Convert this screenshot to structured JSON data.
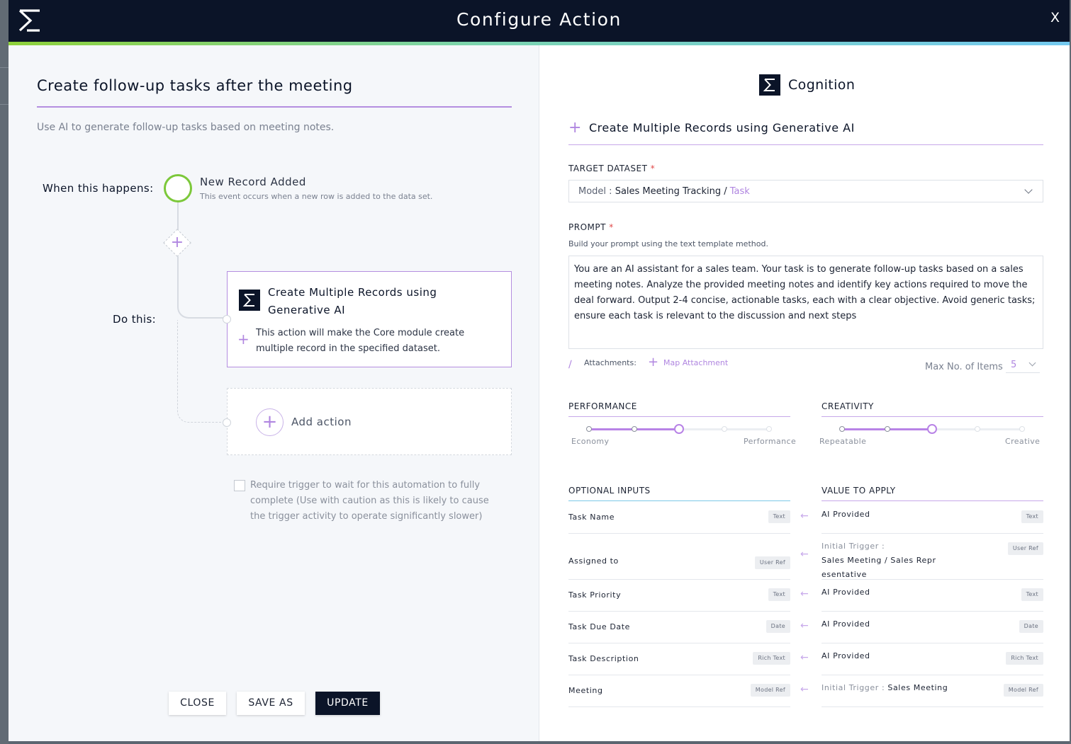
{
  "window": {
    "title": "Configure Action",
    "close_label": "X"
  },
  "workflow": {
    "title": "Create follow-up tasks after the meeting",
    "description": "Use AI to generate follow-up tasks based on meeting notes.",
    "when_label": "When this happens:",
    "do_label": "Do this:",
    "trigger": {
      "name": "New Record Added",
      "description": "This event occurs when a new row is added to the data set."
    },
    "action": {
      "title": "Create Multiple Records using Generative AI",
      "description": "This action will make the Core module create multiple record in the specified dataset."
    },
    "add_action_label": "Add action",
    "wait_checkbox": {
      "checked": false,
      "label": "Require trigger to wait for this automation to fully complete (Use with caution as this is likely to cause the trigger activity to operate significantly slower)"
    }
  },
  "buttons": {
    "close": "CLOSE",
    "save_as": "SAVE AS",
    "update": "UPDATE"
  },
  "config": {
    "brand": "Cognition",
    "section_title": "Create Multiple Records using Generative AI",
    "target_dataset": {
      "label": "TARGET DATASET",
      "model_prefix": "Model :",
      "path": "Sales Meeting Tracking /",
      "entity": "Task"
    },
    "prompt": {
      "label": "PROMPT",
      "help": "Build your prompt using the text template method.",
      "text": "You are an AI assistant for a sales team. Your task is to generate follow-up tasks based on a sales meeting notes. Analyze the provided meeting notes and identify key actions required to move the deal forward. Output 2-4 concise, actionable tasks, each with a clear objective. Avoid generic tasks; ensure each task is relevant to the discussion and next steps"
    },
    "attachments_label": "Attachments:",
    "map_attachment_label": "Map Attachment",
    "max_items": {
      "label": "Max No. of Items",
      "value": "5"
    },
    "performance": {
      "label": "PERFORMANCE",
      "min_label": "Economy",
      "max_label": "Performance",
      "level": 3,
      "steps": 5
    },
    "creativity": {
      "label": "CREATIVITY",
      "min_label": "Repeatable",
      "max_label": "Creative",
      "level": 3,
      "steps": 5
    },
    "inputs_header": "OPTIONAL INPUTS",
    "values_header": "VALUE TO APPLY",
    "mappings": [
      {
        "input": "Task Name",
        "input_type": "Text",
        "value_prefix": "",
        "value": "AI Provided",
        "value_type": "Text"
      },
      {
        "input": "Assigned to",
        "input_type": "User Ref",
        "value_prefix": "Initial Trigger :",
        "value": "Sales Meeting / Sales Repr esentative",
        "value_type": "User Ref"
      },
      {
        "input": "Task Priority",
        "input_type": "Text",
        "value_prefix": "",
        "value": "AI Provided",
        "value_type": "Text"
      },
      {
        "input": "Task Due Date",
        "input_type": "Date",
        "value_prefix": "",
        "value": "AI Provided",
        "value_type": "Date"
      },
      {
        "input": "Task Description",
        "input_type": "Rich Text",
        "value_prefix": "",
        "value": "AI Provided",
        "value_type": "Rich Text"
      },
      {
        "input": "Meeting",
        "input_type": "Model Ref",
        "value_prefix": "Initial Trigger :",
        "value": "Sales Meeting",
        "value_type": "Model Ref"
      }
    ]
  },
  "colors": {
    "header_bg": "#0b1428",
    "accent": "#b086e0",
    "trigger_ring": "#7cc83a"
  },
  "icons": {
    "brand": "sigma-icon",
    "close": "close-icon",
    "add": "plus-icon",
    "attach": "paperclip-icon",
    "mapping_arrow": "arrow-left-icon"
  }
}
